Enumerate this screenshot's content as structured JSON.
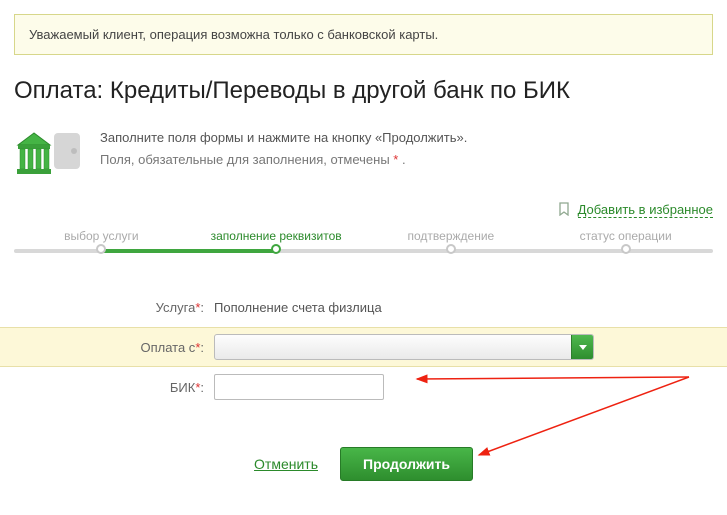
{
  "notice": "Уважаемый клиент, операция возможна только с банковской карты.",
  "page_title": "Оплата: Кредиты/Переводы в другой банк по БИК",
  "intro": {
    "line1": "Заполните поля формы и нажмите на кнопку «Продолжить».",
    "line2_prefix": "Поля, обязательные для заполнения, отмечены ",
    "line2_suffix": " ."
  },
  "favorite_label": "Добавить в избранное",
  "steps": {
    "s1": "выбор услуги",
    "s2": "заполнение реквизитов",
    "s3": "подтверждение",
    "s4": "статус операции"
  },
  "form": {
    "service_label": "Услуга",
    "service_value": "Пополнение счета физлица",
    "payfrom_label": "Оплата с",
    "payfrom_value": "",
    "bik_label": "БИК",
    "bik_value": ""
  },
  "actions": {
    "cancel": "Отменить",
    "continue": "Продолжить"
  },
  "colors": {
    "accent": "#3fa63f",
    "star": "#d33"
  }
}
